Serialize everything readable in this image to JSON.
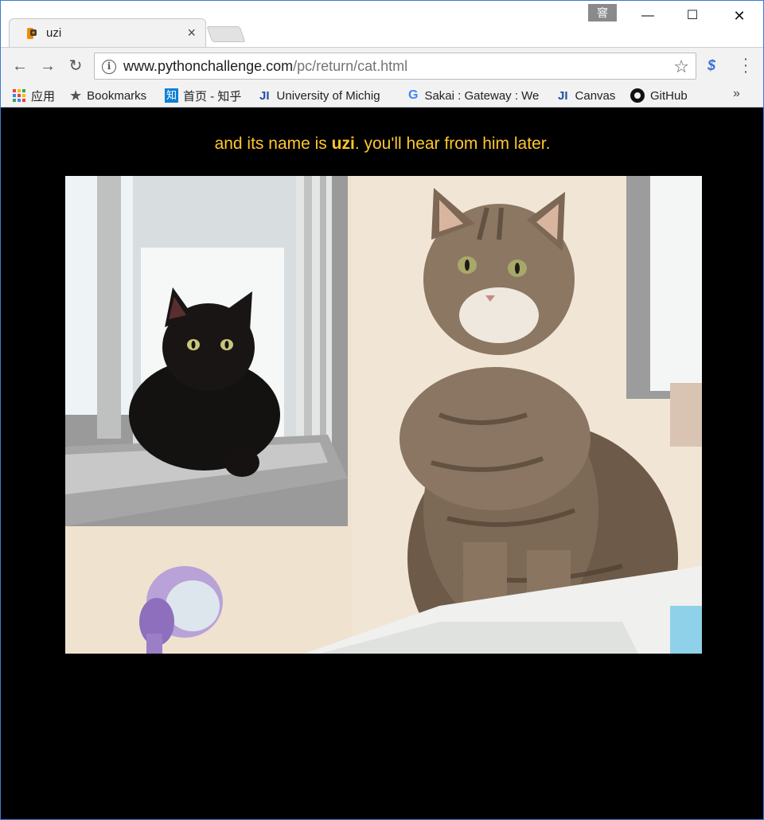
{
  "browser": {
    "tab_title": "uzi",
    "profile_badge": "窨",
    "url_host": "www.pythonchallenge.com",
    "url_path": "/pc/return/cat.html"
  },
  "bookmarks": [
    {
      "label": "应用",
      "icon": "apps-grid-icon"
    },
    {
      "label": "Bookmarks",
      "icon": "star-icon"
    },
    {
      "label": "首页 - 知乎",
      "icon": "zhihu-icon",
      "icon_text": "知"
    },
    {
      "label": "University of Michig",
      "icon": "ji-icon",
      "icon_text": "JI"
    },
    {
      "label": "Sakai : Gateway : We",
      "icon": "google-icon",
      "icon_text": "G"
    },
    {
      "label": "Canvas",
      "icon": "ji-icon",
      "icon_text": "JI"
    },
    {
      "label": "GitHub",
      "icon": "github-icon"
    }
  ],
  "bookmarks_more": "»",
  "page": {
    "text_before": "and its name is ",
    "name": "uzi",
    "text_after": ". you'll hear from him later.",
    "text_color": "#ffc72c",
    "image": "photo of a black cat sitting in a window and a tabby long-haired cat sitting on a white surface"
  }
}
